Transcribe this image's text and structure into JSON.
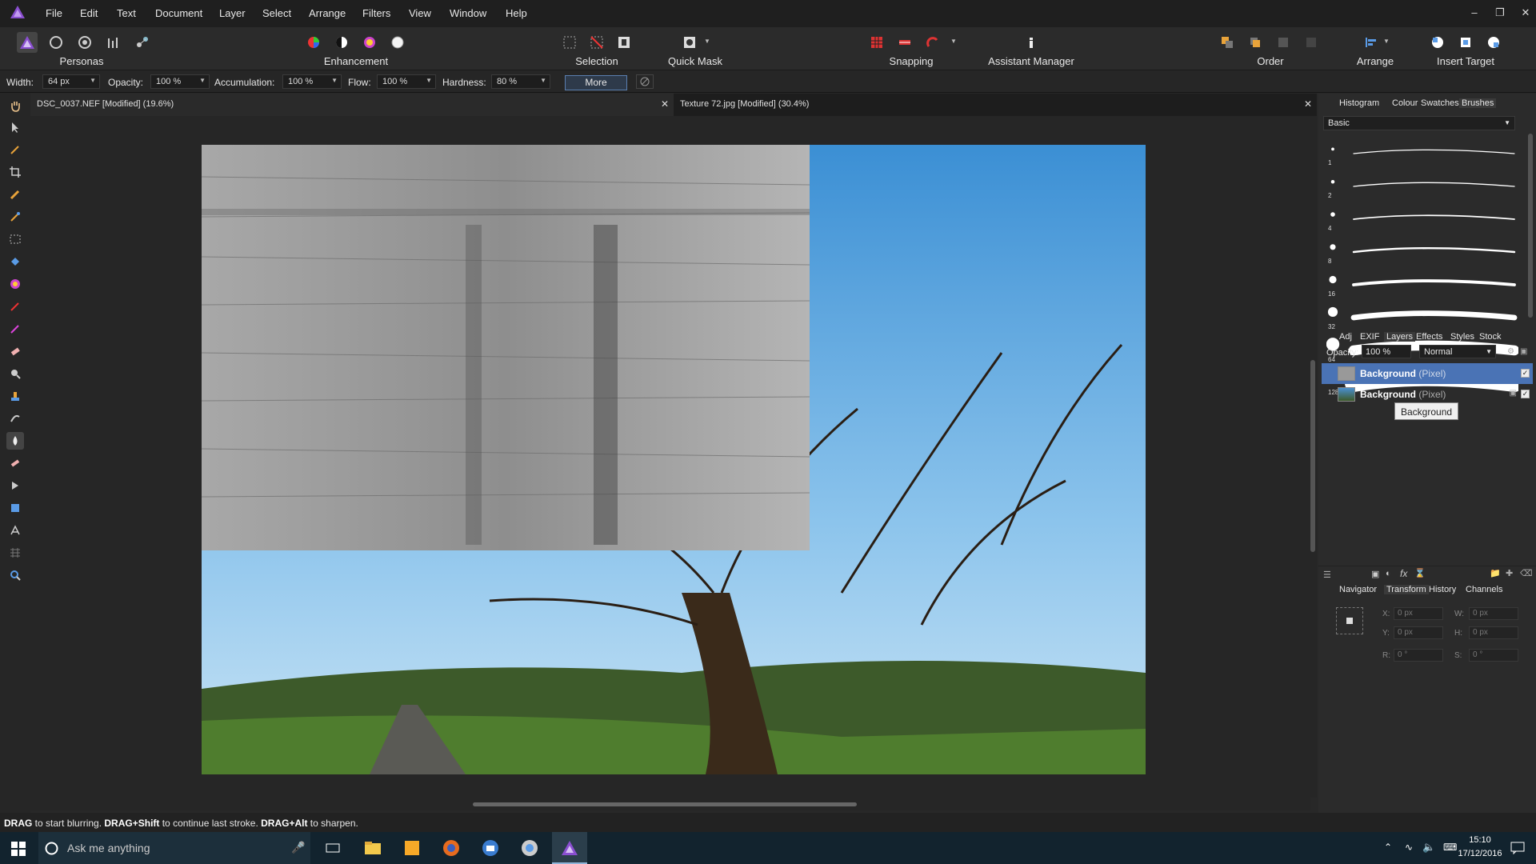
{
  "menubar": {
    "items": [
      "File",
      "Edit",
      "Text",
      "Document",
      "Layer",
      "Select",
      "Arrange",
      "Filters",
      "View",
      "Window",
      "Help"
    ]
  },
  "toolbar": {
    "personas_label": "Personas",
    "enhancement_label": "Enhancement",
    "selection_label": "Selection",
    "quickmask_label": "Quick Mask",
    "snapping_label": "Snapping",
    "assistant_label": "Assistant Manager",
    "order_label": "Order",
    "arrange_label": "Arrange",
    "insert_target_label": "Insert Target"
  },
  "context": {
    "width_label": "Width:",
    "width_value": "64 px",
    "opacity_label": "Opacity:",
    "opacity_value": "100 %",
    "accumulation_label": "Accumulation:",
    "accumulation_value": "100 %",
    "flow_label": "Flow:",
    "flow_value": "100 %",
    "hardness_label": "Hardness:",
    "hardness_value": "80 %",
    "more_label": "More"
  },
  "documents": {
    "tab1": "DSC_0037.NEF [Modified] (19.6%)",
    "tab2": "Texture 72.jpg [Modified] (30.4%)"
  },
  "panels": {
    "top_tabs": [
      "Histogram",
      "Colour",
      "Swatches",
      "Brushes"
    ],
    "active_top_tab": "Brushes",
    "brush_category": "Basic",
    "brush_sizes": [
      "1",
      "2",
      "4",
      "8",
      "16",
      "32",
      "64",
      "128"
    ],
    "mid_tabs": [
      "Adj",
      "EXIF",
      "Layers",
      "Effects",
      "Styles",
      "Stock"
    ],
    "active_mid_tab": "Layers",
    "layers_opacity_label": "Opacity:",
    "layers_opacity_value": "100 %",
    "blend_mode": "Normal",
    "layers": [
      {
        "name": "Background",
        "type": "(Pixel)"
      },
      {
        "name": "Background",
        "type": "(Pixel)"
      }
    ],
    "tooltip": "Background",
    "bottom_tabs": [
      "Navigator",
      "Transform",
      "History",
      "Channels"
    ],
    "active_bottom_tab": "Transform",
    "transform": {
      "x_label": "X:",
      "x": "0 px",
      "y_label": "Y:",
      "y": "0 px",
      "w_label": "W:",
      "w": "0 px",
      "h_label": "H:",
      "h": "0 px",
      "r_label": "R:",
      "r": "0 °",
      "s_label": "S:",
      "s": "0 °"
    }
  },
  "status": {
    "a": "DRAG",
    "b": " to start blurring. ",
    "c": "DRAG+Shift",
    "d": " to continue last stroke. ",
    "e": "DRAG+Alt",
    "f": " to sharpen."
  },
  "taskbar": {
    "search_placeholder": "Ask me anything",
    "time": "15:10",
    "date": "17/12/2016"
  },
  "colors": {
    "accent": "#4a73b5",
    "sky": "#5aa0d8"
  }
}
